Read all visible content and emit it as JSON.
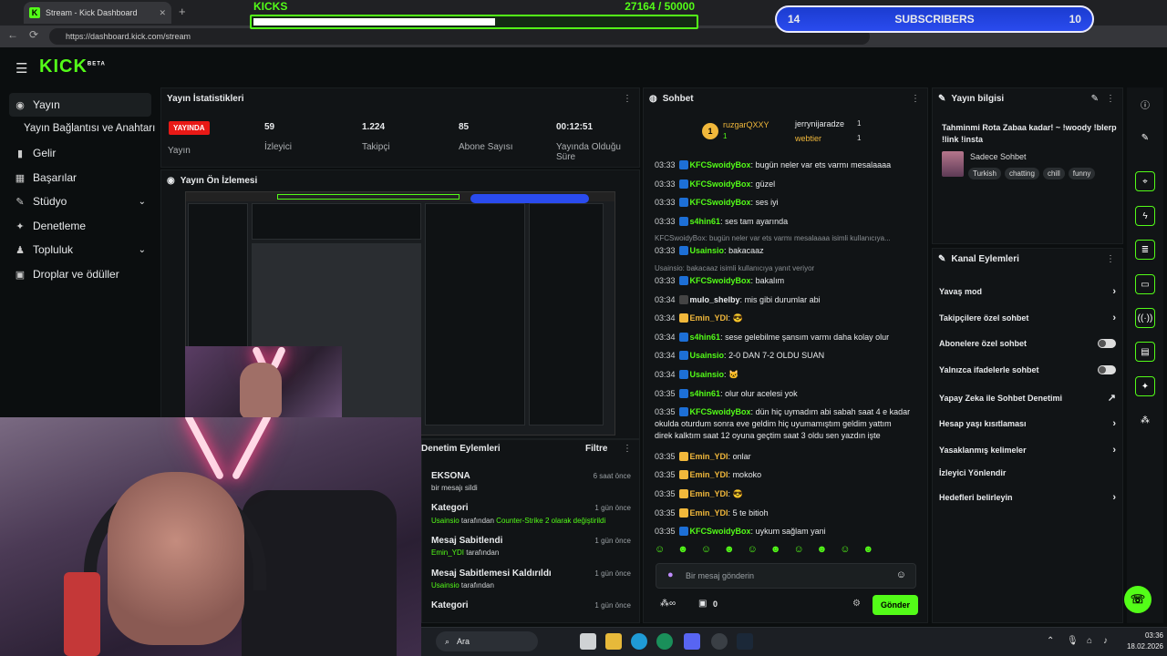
{
  "browser": {
    "tab_title": "Stream - Kick Dashboard",
    "url": "https://dashboard.kick.com/stream"
  },
  "overlays": {
    "kicks_label": "KICKS",
    "kicks_progress": "27164 / 50000",
    "kicks_current": 27164,
    "kicks_goal": 50000,
    "subs_left": "14",
    "subs_label": "SUBSCRIBERS",
    "subs_right": "10"
  },
  "brand": {
    "logo": "KICK",
    "badge": "BETA"
  },
  "sidebar": [
    {
      "label": "Yayın",
      "icon": "broadcast-icon"
    },
    {
      "label": "Yayın Bağlantısı ve Anahtarı",
      "icon": ""
    },
    {
      "label": "Gelir",
      "icon": "chart-icon"
    },
    {
      "label": "Başarılar",
      "icon": "grid-icon"
    },
    {
      "label": "Stüdyo",
      "icon": "brush-icon"
    },
    {
      "label": "Denetleme",
      "icon": "wrench-icon"
    },
    {
      "label": "Topluluk",
      "icon": "people-icon"
    },
    {
      "label": "Droplar ve ödüller",
      "icon": "gift-icon"
    }
  ],
  "stats": {
    "title": "Yayın İstatistikleri",
    "live_badge": "YAYINDA",
    "items": [
      {
        "value": "",
        "label": "Yayın"
      },
      {
        "value": "59",
        "label": "İzleyici"
      },
      {
        "value": "1.224",
        "label": "Takipçi"
      },
      {
        "value": "85",
        "label": "Abone Sayısı"
      },
      {
        "value": "00:12:51",
        "label": "Yayında Olduğu Süre"
      }
    ]
  },
  "preview": {
    "title": "Yayın Ön İzlemesi"
  },
  "moderation": {
    "title": "Denetim Eylemleri",
    "filter": "Filtre",
    "items": [
      {
        "title": "EKSONA",
        "pre": "bir mesajı sildi",
        "mid": "",
        "post": "",
        "time": "6 saat önce"
      },
      {
        "title": "Kategori",
        "pre": "Usainsio",
        "mid": " tarafından ",
        "post": "Counter-Strike 2 olarak değiştirildi",
        "time": "1 gün önce"
      },
      {
        "title": "Mesaj Sabitlendi",
        "pre": "Emin_YDI",
        "mid": " tarafından",
        "post": "",
        "time": "1 gün önce"
      },
      {
        "title": "Mesaj Sabitlemesi Kaldırıldı",
        "pre": "Usainsio",
        "mid": " tarafından",
        "post": "",
        "time": "1 gün önce"
      },
      {
        "title": "Kategori",
        "pre": "",
        "mid": "",
        "post": "",
        "time": "1 gün önce"
      }
    ]
  },
  "chat": {
    "title": "Sohbet",
    "top": [
      {
        "name": "ruzgarQXXY",
        "count": "1"
      },
      {
        "name": "jerrynijaradze",
        "count": "1"
      },
      {
        "name": "webtier",
        "count": "1"
      }
    ],
    "messages": [
      {
        "time": "03:33",
        "user": "KFCSwoidyBox",
        "text": "bugün neler var ets varmı mesalaaaa",
        "c": "g"
      },
      {
        "time": "03:33",
        "user": "KFCSwoidyBox",
        "text": "güzel",
        "c": "g"
      },
      {
        "time": "03:33",
        "user": "KFCSwoidyBox",
        "text": "ses iyi",
        "c": "g"
      },
      {
        "time": "03:33",
        "user": "s4hin61",
        "text": "ses tam ayarında",
        "c": "g"
      },
      {
        "time": "03:33",
        "user": "Usainsio",
        "text": "bakacaaz",
        "c": "g",
        "reply": "KFCSwoidyBox: bugün neler var ets varmı mesalaaaa isimli kullanıcıya..."
      },
      {
        "time": "03:33",
        "user": "KFCSwoidyBox",
        "text": "bakalım",
        "c": "g",
        "reply": "Usainsio: bakacaaz isimli kullanıcıya yanıt veriyor"
      },
      {
        "time": "03:34",
        "user": "mulo_shelby",
        "text": "mis gibi durumlar abi",
        "c": "w"
      },
      {
        "time": "03:34",
        "user": "Emin_YDI",
        "text": "😎",
        "c": "y"
      },
      {
        "time": "03:34",
        "user": "s4hin61",
        "text": "sese gelebilme şansım varmı daha kolay olur",
        "c": "g"
      },
      {
        "time": "03:34",
        "user": "Usainsio",
        "text": "2-0 DAN 7-2 OLDU SUAN",
        "c": "g"
      },
      {
        "time": "03:34",
        "user": "Usainsio",
        "text": "🐱",
        "c": "g"
      },
      {
        "time": "03:35",
        "user": "s4hin61",
        "text": "olur olur acelesi yok",
        "c": "g"
      },
      {
        "time": "03:35",
        "user": "KFCSwoidyBox",
        "text": "dün hiç uymadım abi sabah saat 4 e kadar",
        "c": "g",
        "cont": [
          "okulda oturdum sonra eve geldim hiç uyumamıştım geldim yattım",
          "direk kalktım saat 12 oyuna geçtim saat 3 oldu sen yazdın işte"
        ]
      },
      {
        "time": "03:35",
        "user": "Emin_YDI",
        "text": "onlar",
        "c": "y"
      },
      {
        "time": "03:35",
        "user": "Emin_YDI",
        "text": "mokoko",
        "c": "y"
      },
      {
        "time": "03:35",
        "user": "Emin_YDI",
        "text": "😎",
        "c": "y"
      },
      {
        "time": "03:35",
        "user": "Emin_YDI",
        "text": "5 te bitioh",
        "c": "y"
      },
      {
        "time": "03:35",
        "user": "KFCSwoidyBox",
        "text": "uykum sağlam yani",
        "c": "g"
      }
    ],
    "input_placeholder": "Bir mesaj gönderin",
    "points": "0",
    "send": "Gönder"
  },
  "info": {
    "title": "Yayın bilgisi",
    "stream_title": "Tahminmi Rota Zabaa kadar! ~ !woody !blerp !link !insta",
    "category": "Sadece Sohbet",
    "tags": [
      "Turkish",
      "chatting",
      "chill",
      "funny"
    ]
  },
  "channel_actions": {
    "title": "Kanal Eylemleri",
    "items": [
      {
        "label": "Yavaş mod",
        "kind": "chevron"
      },
      {
        "label": "Takipçilere özel sohbet",
        "kind": "chevron"
      },
      {
        "label": "Abonelere özel sohbet",
        "kind": "toggle"
      },
      {
        "label": "Yalnızca ifadelerle sohbet",
        "kind": "toggle"
      },
      {
        "label": "Yapay Zeka ile Sohbet Denetimi",
        "kind": "external"
      },
      {
        "label": "Hesap yaşı kısıtlaması",
        "kind": "chevron"
      },
      {
        "label": "Yasaklanmış kelimeler",
        "kind": "chevron"
      },
      {
        "label": "İzleyici Yönlendir",
        "kind": "none"
      },
      {
        "label": "Hedefleri belirleyin",
        "kind": "chevron"
      }
    ]
  },
  "taskbar": {
    "search": "Ara",
    "time": "03:36",
    "date": "18.02.2026"
  },
  "colors": {
    "accent": "#53fc18",
    "bg": "#0b0e0f",
    "panel": "#111416",
    "live": "#e91916",
    "subs": "#2a4bee"
  }
}
